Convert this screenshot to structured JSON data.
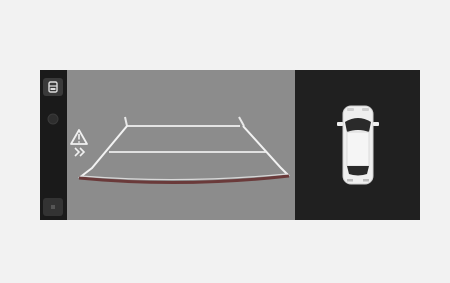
{
  "screen": {
    "background": "#1e1e1e",
    "camera_background": "#8c8c8c",
    "topview_background": "#202020"
  },
  "left_bar": {
    "items": [
      {
        "icon": "camera-view-icon"
      },
      {
        "icon": "circle-indicator-icon"
      },
      {
        "icon": "small-dot-icon"
      }
    ]
  },
  "camera": {
    "warning_icon": "warning-triangle-icon",
    "motion_icon": "double-chevron-icon",
    "guide_line_color": "#e8e8e8",
    "red_curve_color": "#6a3a3a"
  },
  "topview": {
    "vehicle_icon": "car-top-view-icon"
  }
}
